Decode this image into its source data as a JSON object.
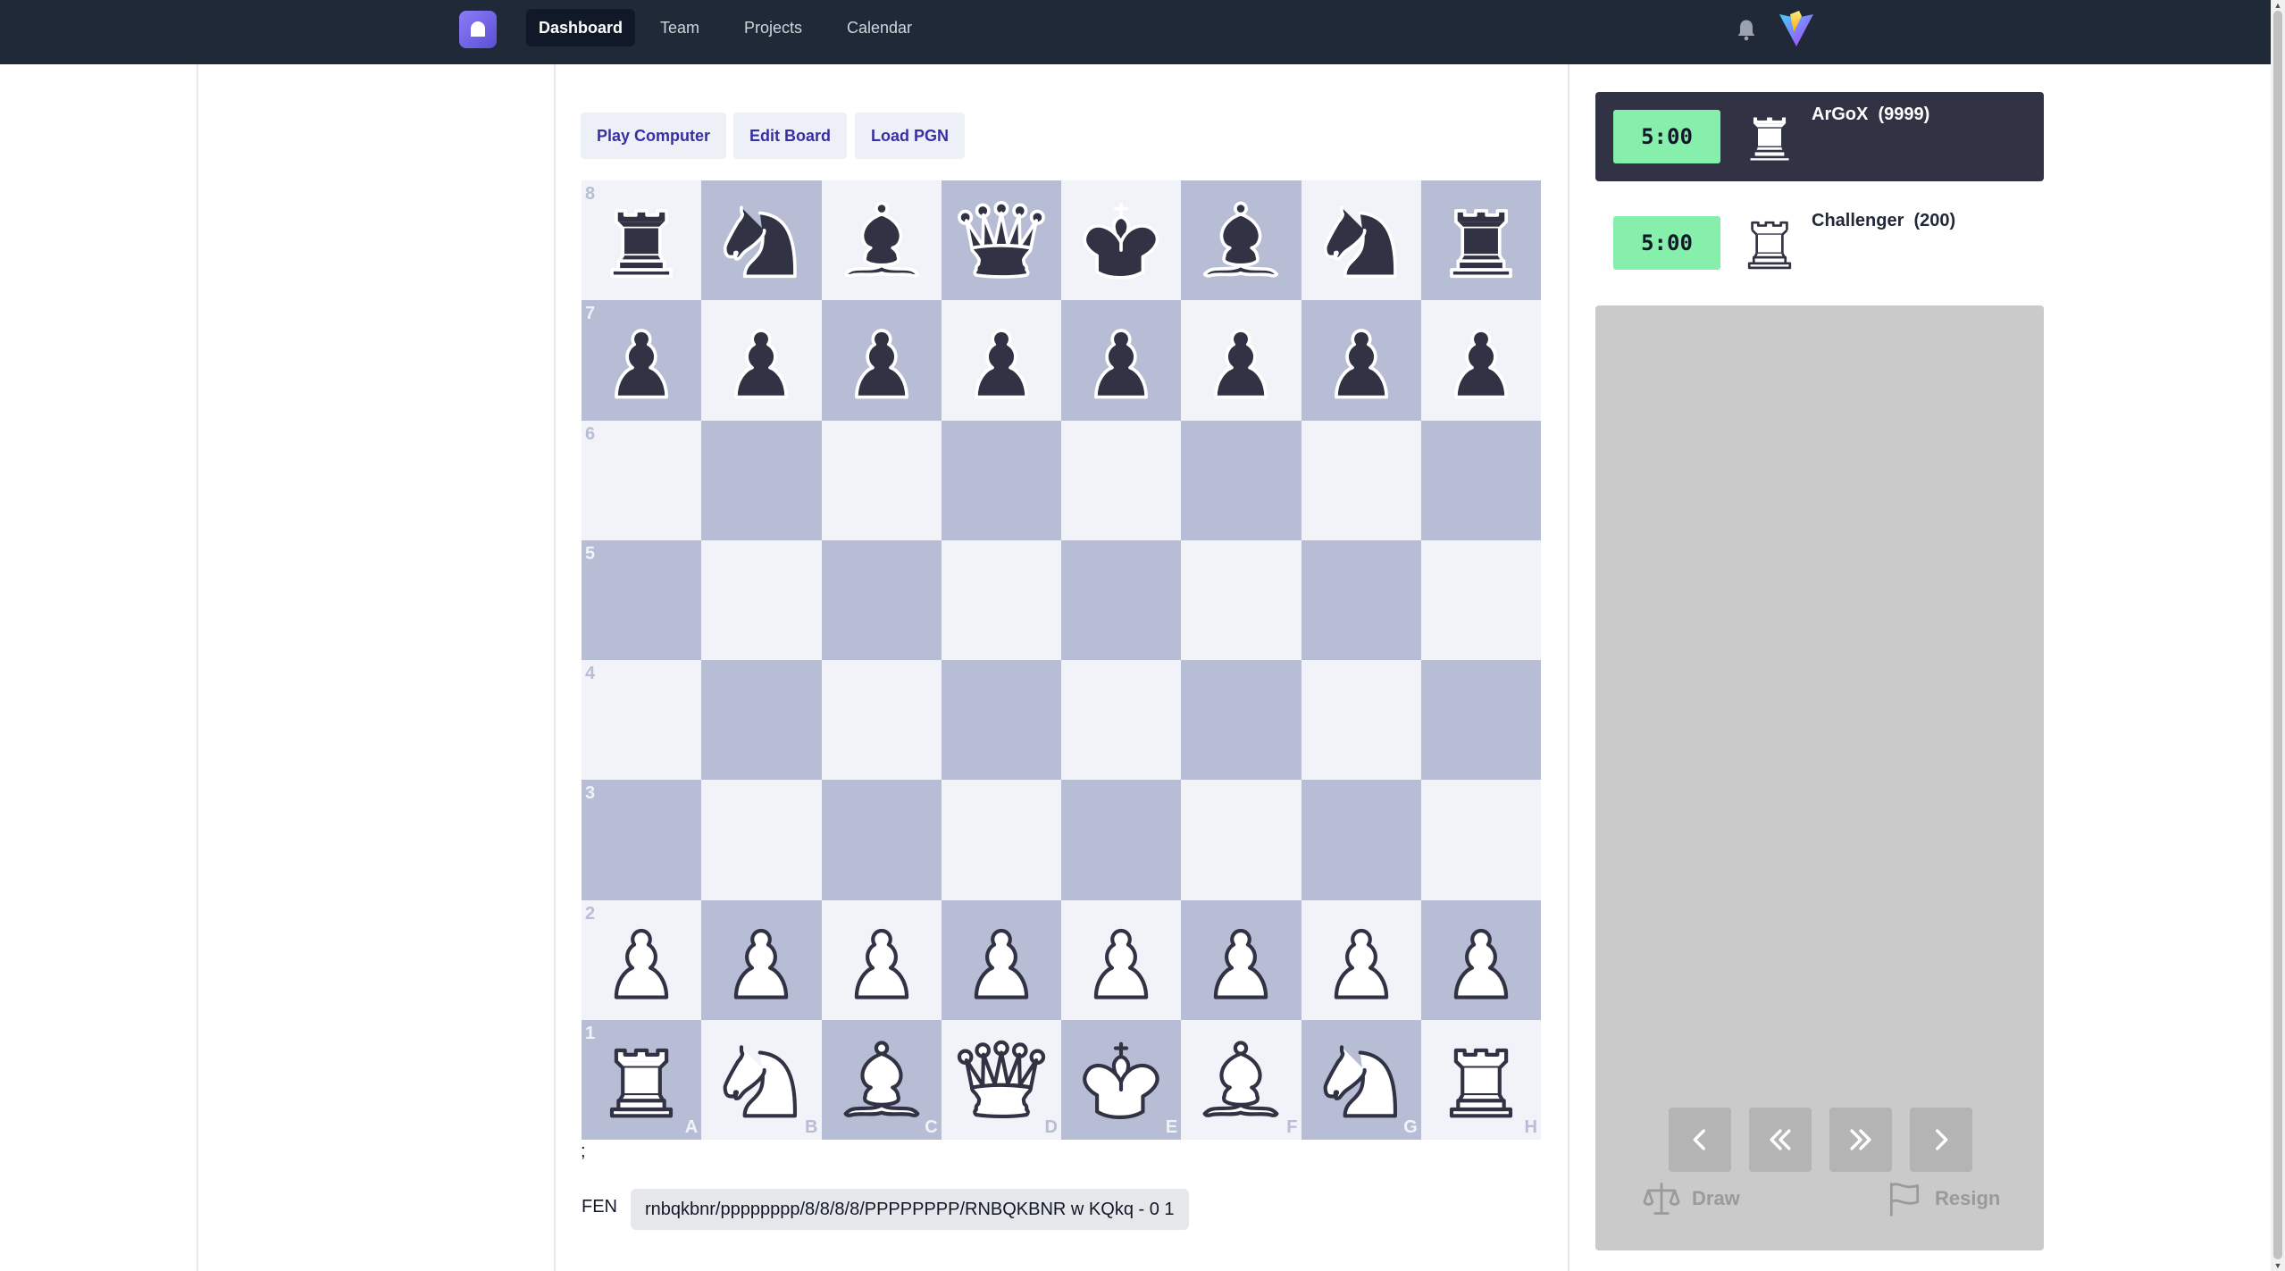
{
  "nav": {
    "items": [
      "Dashboard",
      "Team",
      "Projects",
      "Calendar"
    ],
    "active": "Dashboard"
  },
  "toolbar": {
    "play_computer": "Play Computer",
    "edit_board": "Edit Board",
    "load_pgn": "Load PGN"
  },
  "board": {
    "ranks": [
      "8",
      "7",
      "6",
      "5",
      "4",
      "3",
      "2",
      "1"
    ],
    "files": [
      "A",
      "B",
      "C",
      "D",
      "E",
      "F",
      "G",
      "H"
    ],
    "light_color": "#f1f3f8",
    "dark_color": "#b7bdd4",
    "position": [
      [
        "br",
        "bn",
        "bb",
        "bq",
        "bk",
        "bb",
        "bn",
        "br"
      ],
      [
        "bp",
        "bp",
        "bp",
        "bp",
        "bp",
        "bp",
        "bp",
        "bp"
      ],
      [
        "",
        "",
        "",
        "",
        "",
        "",
        "",
        ""
      ],
      [
        "",
        "",
        "",
        "",
        "",
        "",
        "",
        ""
      ],
      [
        "",
        "",
        "",
        "",
        "",
        "",
        "",
        ""
      ],
      [
        "",
        "",
        "",
        "",
        "",
        "",
        "",
        ""
      ],
      [
        "wp",
        "wp",
        "wp",
        "wp",
        "wp",
        "wp",
        "wp",
        "wp"
      ],
      [
        "wr",
        "wn",
        "wb",
        "wq",
        "wk",
        "wb",
        "wn",
        "wr"
      ]
    ]
  },
  "stray_text": ";",
  "fen": {
    "label": "FEN",
    "value": "rnbqkbnr/pppppppp/8/8/8/8/PPPPPPPP/RNBQKBNR w KQkq - 0 1"
  },
  "players": {
    "top": {
      "clock": "5:00",
      "name": "ArGoX  (9999)",
      "icon": "rook-icon"
    },
    "bottom": {
      "clock": "5:00",
      "name": "Challenger  (200)",
      "icon": "rook-icon"
    }
  },
  "controls": {
    "draw_label": "Draw",
    "resign_label": "Resign"
  }
}
